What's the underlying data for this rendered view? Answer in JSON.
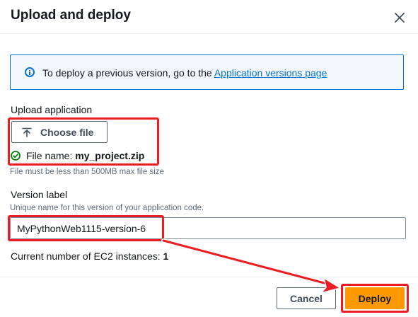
{
  "dialog": {
    "title": "Upload and deploy"
  },
  "info": {
    "text": "To deploy a previous version, go to the",
    "link": "Application versions page"
  },
  "upload": {
    "label": "Upload application",
    "button_label": "Choose file",
    "file_name_prefix": "File name:",
    "file_name": "my_project.zip",
    "hint": "File must be less than 500MB max file size"
  },
  "version": {
    "label": "Version label",
    "hint": "Unique name for this version of your application code.",
    "value": "MyPythonWeb1115-version-6"
  },
  "instances": {
    "label": "Current number of EC2 instances:",
    "count": "1"
  },
  "footer": {
    "cancel_label": "Cancel",
    "deploy_label": "Deploy"
  },
  "colors": {
    "primary": "#ff9900",
    "link": "#0972d3",
    "success": "#037f0c",
    "annotation": "#ec1c24"
  }
}
